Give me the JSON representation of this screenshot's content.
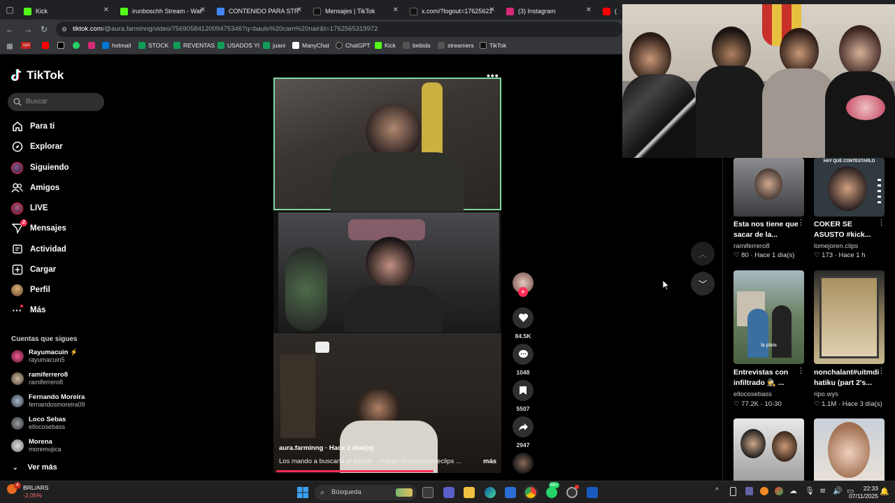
{
  "browser": {
    "tabs": [
      {
        "label": "Kick",
        "color": "#53fc18"
      },
      {
        "label": "irunboschh Stream - Watc",
        "color": "#53fc18"
      },
      {
        "label": "CONTENIDO PARA STREA",
        "color": "#4285f4"
      },
      {
        "label": "Mensajes | TikTok",
        "color": "#000000"
      },
      {
        "label": "x.com/?logout=17625621",
        "color": "#000000"
      },
      {
        "label": "(3) Instagram",
        "color": "#d62976"
      },
      {
        "label": "(4",
        "color": "#ff0000"
      }
    ],
    "url_host": "tiktok.com",
    "url_rest": "/@aura.farminng/video/7569058412009475346?q=baulo%20cam%20nair&t=1762565319972",
    "bookmarks": [
      "ups",
      "",
      "",
      "",
      "",
      "hotmail",
      "STOCK",
      "REVENTAS",
      "USADOS YI",
      "juani",
      "ManyChat",
      "ChatGPT",
      "Kick",
      "bebida",
      "streamers",
      "TikTok"
    ]
  },
  "tiktok": {
    "logo": "TikTok",
    "search_placeholder": "Buscar",
    "nav": [
      {
        "label": "Para ti",
        "icon": "home-icon"
      },
      {
        "label": "Explorar",
        "icon": "compass-icon"
      },
      {
        "label": "Siguiendo",
        "icon": "following-icon"
      },
      {
        "label": "Amigos",
        "icon": "friends-icon"
      },
      {
        "label": "LIVE",
        "icon": "live-icon"
      },
      {
        "label": "Mensajes",
        "icon": "messages-icon",
        "badge": "2"
      },
      {
        "label": "Actividad",
        "icon": "activity-icon"
      },
      {
        "label": "Cargar",
        "icon": "upload-icon"
      },
      {
        "label": "Perfil",
        "icon": "profile-icon"
      },
      {
        "label": "Más",
        "icon": "more-icon"
      }
    ],
    "following_title": "Cuentas que sigues",
    "following": [
      {
        "name": "Rayumacuin",
        "handle": "rayumacuin5"
      },
      {
        "name": "ramiferrero8",
        "handle": "ramiferrero8"
      },
      {
        "name": "Fernando Moreira",
        "handle": "fernandosmoreira09"
      },
      {
        "name": "Loco Sebas",
        "handle": "ellocosebass"
      },
      {
        "name": "Morena",
        "handle": "moremujica"
      }
    ],
    "see_more": "Ver más",
    "video": {
      "author_line": "aura.farminng · Hace 2 días(s)",
      "caption": "Los mando a buscarla al ángulo . #baulo  #bautiagnoneclips  ...",
      "more": "más",
      "progress": 0.69,
      "likes": "84.5K",
      "comments": "1048",
      "saves": "5507",
      "shares": "2947"
    },
    "cards": [
      {
        "title": "Esta nos tiene que sacar de la...",
        "author": "ramiferrero8",
        "likes": "80",
        "time": "Hace 1 día(s)"
      },
      {
        "title": "COKER SE ASUSTO #kick...",
        "author": "lomejoren.clips",
        "likes": "173",
        "time": "Hace 1 h",
        "overlay": "HAY QUE CONTESTARLO"
      },
      {
        "title": "Entrevistas con infiltrado 🕵 ...",
        "author": "ellocosebass",
        "likes": "77.2K",
        "time": "10-30",
        "overlay": "la plata"
      },
      {
        "title": "nonchalant#uitmdi hatiku (part 2's...",
        "author": "ripo.wys",
        "likes": "1.1M",
        "time": "Hace 3 día(s)"
      }
    ]
  },
  "taskbar": {
    "stock_badge": "4",
    "stock_label": "BRL/ARS",
    "stock_change": "-2,05%",
    "search_label": "Búsqueda",
    "whatsapp_badge": "99+",
    "time": "22:33",
    "date": "07/11/2025"
  }
}
